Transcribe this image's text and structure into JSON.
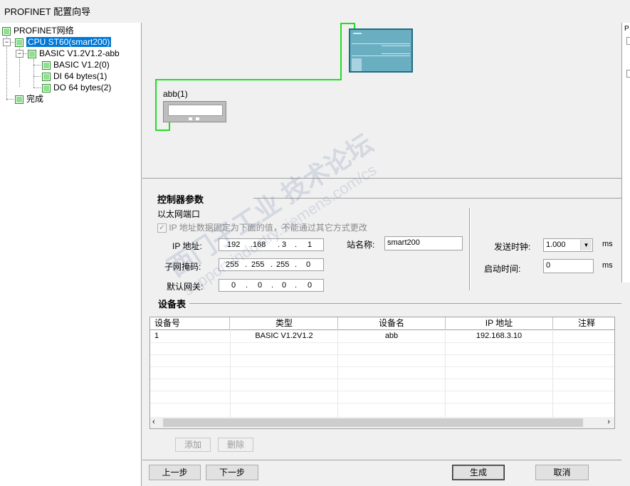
{
  "window": {
    "title": "PROFINET 配置向导"
  },
  "tree": {
    "root": "PROFINET网络",
    "cpu": "CPU ST60(smart200)",
    "device": "BASIC V1.2V1.2-abb",
    "modules": [
      "BASIC V1.2(0)",
      "DI 64 bytes(1)",
      "DO 64 bytes(2)"
    ],
    "finish": "完成"
  },
  "network": {
    "device_label": "abb(1)",
    "link_color": "#22dd22"
  },
  "right_panel": {
    "letter": "P"
  },
  "controller": {
    "section_title": "控制器参数",
    "port_label": "以太网端口",
    "fixed_ip_text": "IP 地址数据固定为下面的值，不能通过其它方式更改",
    "ip_label": "IP 地址:",
    "ip": [
      "192",
      "168",
      "3",
      "1"
    ],
    "subnet_label": "子网掩码:",
    "subnet": [
      "255",
      "255",
      "255",
      "0"
    ],
    "gateway_label": "默认网关:",
    "gateway": [
      "0",
      "0",
      "0",
      "0"
    ],
    "station_label": "站名称:",
    "station_name": "smart200",
    "send_clock_label": "发送时钟:",
    "send_clock_value": "1.000",
    "send_clock_unit": "ms",
    "startup_label": "启动时间:",
    "startup_value": "0",
    "startup_unit": "ms"
  },
  "device_table": {
    "section_title": "设备表",
    "columns": [
      "设备号",
      "类型",
      "设备名",
      "IP 地址",
      "注释"
    ],
    "rows": [
      [
        "1",
        "BASIC V1.2V1.2",
        "abb",
        "192.168.3.10",
        ""
      ]
    ]
  },
  "table_buttons": {
    "add": "添加",
    "delete": "删除"
  },
  "footer": {
    "prev": "上一步",
    "next": "下一步",
    "generate": "生成",
    "cancel": "取消"
  },
  "watermark": {
    "line1": "西门子工业 技术论坛",
    "line2": "support.industry.siemens.com/cs"
  }
}
